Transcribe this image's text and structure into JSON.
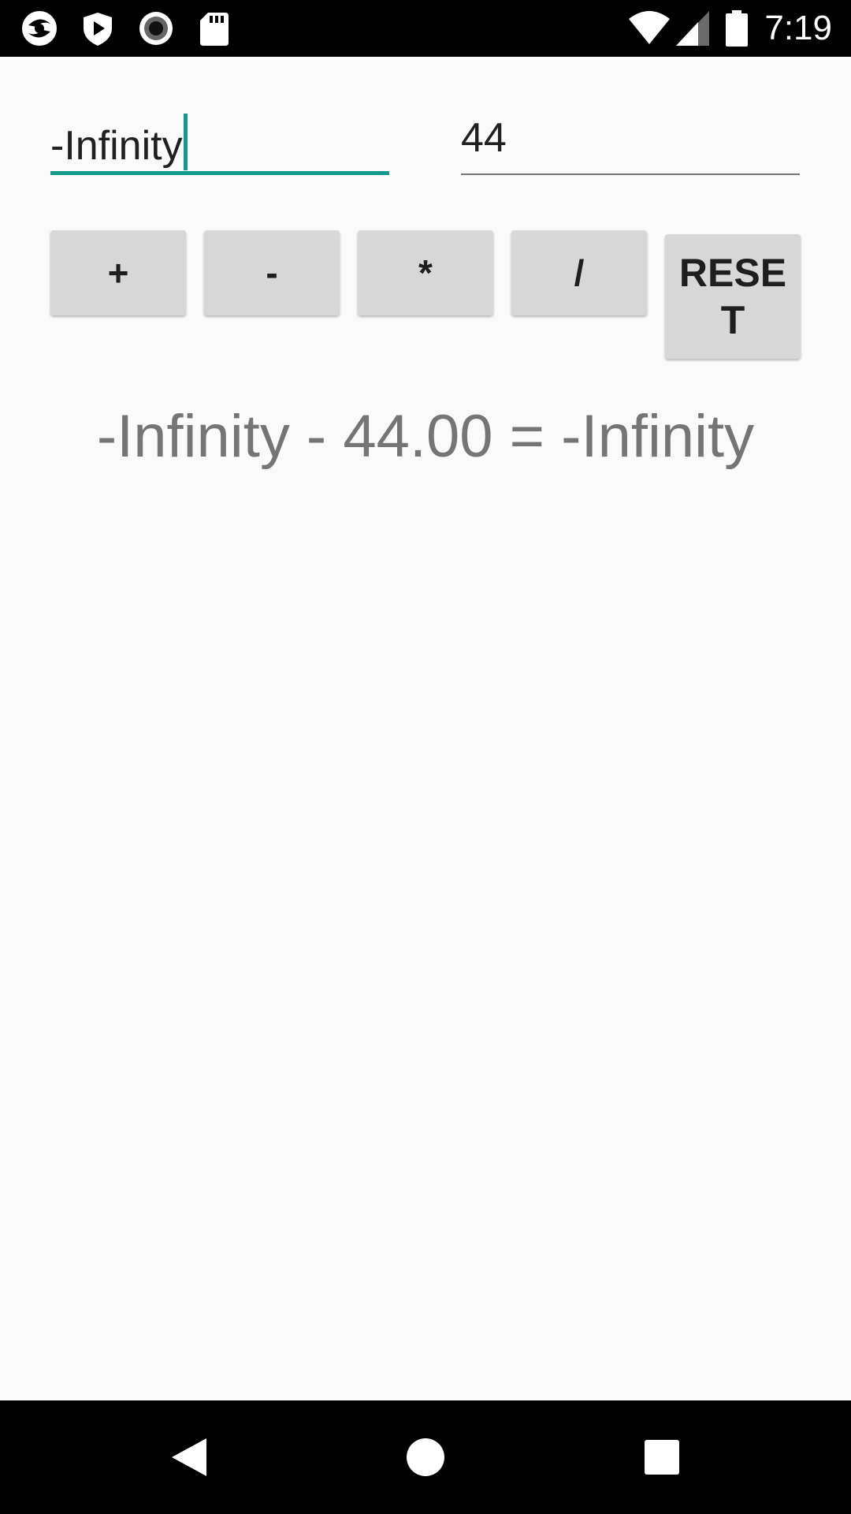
{
  "status_bar": {
    "time": "7:19",
    "icons_left": [
      "app-logo-icon",
      "shield-play-icon",
      "record-icon",
      "sd-card-icon"
    ],
    "icons_right": [
      "wifi-icon",
      "cell-signal-icon",
      "battery-icon"
    ]
  },
  "inputs": {
    "first_value": "-Infinity",
    "second_value": "44",
    "accent_color": "#129a8b"
  },
  "buttons": {
    "add_label": "+",
    "subtract_label": "-",
    "multiply_label": "*",
    "divide_label": "/",
    "reset_label": "RESET"
  },
  "result": {
    "text": "-Infinity - 44.00 = -Infinity"
  },
  "nav_bar": {
    "icons": [
      "back-icon",
      "home-icon",
      "recents-icon"
    ]
  }
}
